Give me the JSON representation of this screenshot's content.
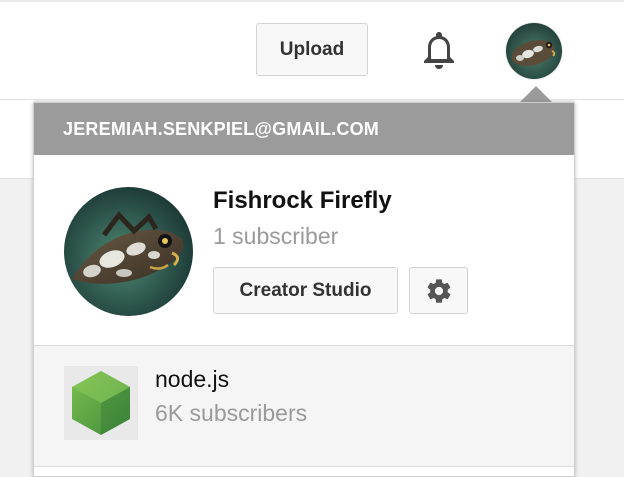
{
  "header": {
    "upload_label": "Upload",
    "notifications_icon": "bell-icon",
    "avatar_icon": "fish-avatar"
  },
  "account_menu": {
    "email": "JEREMIAH.SENKPIEL@GMAIL.COM",
    "channel": {
      "name": "Fishrock Firefly",
      "subscribers": "1 subscriber"
    },
    "creator_studio_label": "Creator Studio",
    "settings_icon": "gear-icon",
    "other_accounts": [
      {
        "name": "node.js",
        "subscribers": "6K subscribers",
        "logo": "nodejs-hexagon-logo"
      }
    ]
  },
  "colors": {
    "menu_header_bg": "#9b9b9b",
    "button_bg": "#f8f8f8",
    "muted_text": "#9a9a9a",
    "node_green": "#5fa04e"
  }
}
